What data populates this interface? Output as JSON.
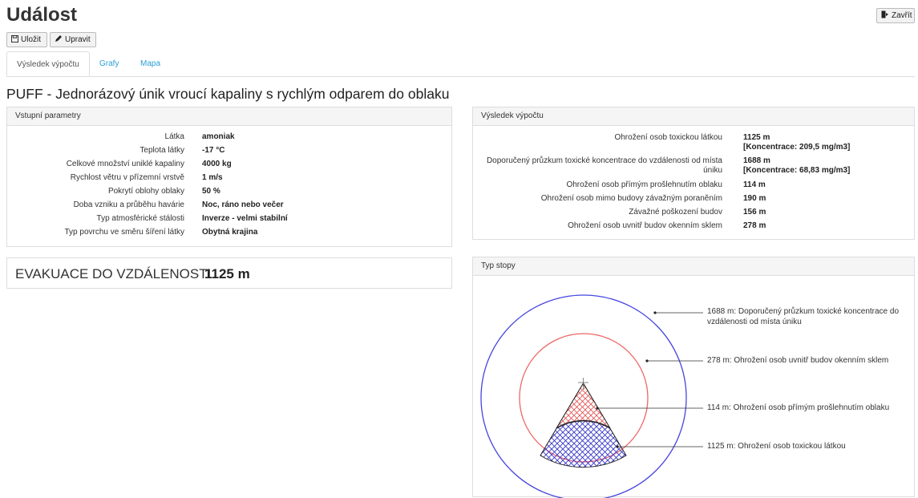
{
  "page": {
    "title": "Událost",
    "save_label": "Uložit",
    "edit_label": "Upravit",
    "close_label": "Zavřít",
    "subtitle": "PUFF - Jednorázový únik vroucí kapaliny s rychlým odparem do oblaku"
  },
  "tabs": [
    {
      "label": "Výsledek výpočtu"
    },
    {
      "label": "Grafy"
    },
    {
      "label": "Mapa"
    }
  ],
  "input_params": {
    "header": "Vstupní parametry",
    "rows": [
      {
        "label": "Látka",
        "value": "amoniak"
      },
      {
        "label": "Teplota látky",
        "value": "-17 °C"
      },
      {
        "label": "Celkové množství uniklé kapaliny",
        "value": "4000 kg"
      },
      {
        "label": "Rychlost větru v přízemní vrstvě",
        "value": "1 m/s"
      },
      {
        "label": "Pokrytí oblohy oblaky",
        "value": "50 %"
      },
      {
        "label": "Doba vzniku a průběhu havárie",
        "value": "Noc, ráno nebo večer"
      },
      {
        "label": "Typ atmosférické stálosti",
        "value": "Inverze - velmi stabilní"
      },
      {
        "label": "Typ povrchu ve směru šíření látky",
        "value": "Obytná krajina"
      }
    ]
  },
  "results": {
    "header": "Výsledek výpočtu",
    "rows": [
      {
        "label": "Ohrožení osob toxickou látkou",
        "value": "1125 m",
        "value2": "[Koncentrace: 209,5 mg/m3]"
      },
      {
        "label": "Doporučený průzkum toxické koncentrace do vzdálenosti od místa",
        "label2": "úniku",
        "value": "1688 m",
        "value2": "[Koncentrace: 68,83 mg/m3]"
      },
      {
        "label": "Ohrožení osob přímým prošlehnutím oblaku",
        "value": "114 m"
      },
      {
        "label": "Ohrožení osob mimo budovy závažným poraněním",
        "value": "190 m"
      },
      {
        "label": "Závažné poškození budov",
        "value": "156 m"
      },
      {
        "label": "Ohrožení osob uvnitř budov okenním sklem",
        "value": "278 m"
      }
    ]
  },
  "evacuation": {
    "label": "EVAKUACE DO VZDÁLENOSTI",
    "value": "1125 m"
  },
  "trace": {
    "header": "Typ stopy",
    "labels": [
      {
        "line1": "1688 m: Doporučený průzkum toxické koncentrace do",
        "line2": "vzdálenosti od místa úniku"
      },
      {
        "line1": "278 m: Ohrožení osob uvnitř budov okenním sklem"
      },
      {
        "line1": "114 m: Ohrožení osob přímým prošlehnutím oblaku"
      },
      {
        "line1": "1125 m: Ohrožení osob toxickou látkou"
      }
    ],
    "colors": {
      "outer": "#4545e0",
      "middle": "#ee6666",
      "sector_red": "#e05050",
      "sector_blue": "#3535c8"
    }
  },
  "icons": {
    "save": "floppy-disk-icon",
    "edit": "pencil-icon",
    "close": "exit-door-icon"
  }
}
